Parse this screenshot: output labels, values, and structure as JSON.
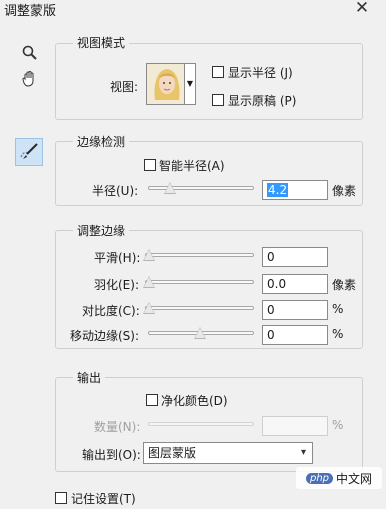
{
  "window": {
    "title": "调整蒙版"
  },
  "colors": {
    "accent": "#3399ff",
    "active_tool_bg": "#cfe3f6"
  },
  "tools": [
    {
      "icon": "zoom-icon"
    },
    {
      "icon": "hand-icon"
    },
    {
      "icon": "refine-radius-brush-icon",
      "active": true
    }
  ],
  "view_mode": {
    "legend": "视图模式",
    "view_label": "视图:",
    "show_radius": "显示半径 (J)",
    "show_original": "显示原稿 (P)"
  },
  "edge_detection": {
    "legend": "边缘检测",
    "smart_radius": "智能半径(A)",
    "radius_label": "半径(U):",
    "radius_value": "4.2",
    "radius_unit": "像素",
    "radius_level": 0.1
  },
  "adjust_edge": {
    "legend": "调整边缘",
    "smooth_label": "平滑(H):",
    "smooth_value": "0",
    "feather_label": "羽化(E):",
    "feather_value": "0.0",
    "feather_unit": "像素",
    "contrast_label": "对比度(C):",
    "contrast_value": "0",
    "contrast_unit": "%",
    "shift_label": "移动边缘(S):",
    "shift_value": "0",
    "shift_unit": "%"
  },
  "output": {
    "legend": "输出",
    "decontaminate": "净化颜色(D)",
    "amount_label": "数量(N):",
    "amount_unit": "%",
    "output_to_label": "输出到(O):",
    "output_to_value": "图层蒙版"
  },
  "remember_settings": "记住设置(T)",
  "watermark": {
    "logo": "php",
    "text": "中文网"
  }
}
